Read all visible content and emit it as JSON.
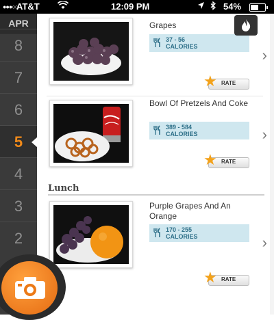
{
  "status_bar": {
    "signal": "●●●○○",
    "carrier": "AT&T",
    "time": "12:09 PM",
    "battery": "54%",
    "wifi_icon": "wifi-icon",
    "location_icon": "location-arrow-icon",
    "bluetooth_icon": "bluetooth-icon"
  },
  "sidebar": {
    "month": "APR",
    "days": [
      "8",
      "7",
      "6",
      "5",
      "4",
      "3",
      "2"
    ],
    "active_day": "5"
  },
  "meals": [
    {
      "title": "Grapes",
      "calories_range": "37 - 56",
      "calories_unit": "CALORIES",
      "rate_label": "RATE"
    },
    {
      "title": "Bowl Of Pretzels And Coke",
      "calories_range": "389 - 584",
      "calories_unit": "CALORIES",
      "rate_label": "RATE"
    },
    {
      "title": "Purple Grapes And An Orange",
      "calories_range": "170 - 255",
      "calories_unit": "CALORIES",
      "rate_label": "RATE"
    }
  ],
  "sections": {
    "lunch": "Lunch"
  },
  "colors": {
    "accent_orange": "#f08a1a",
    "calorie_box": "#cfe7ef",
    "calorie_text": "#2d6f88",
    "sidebar_bg": "#3a3a3a"
  }
}
